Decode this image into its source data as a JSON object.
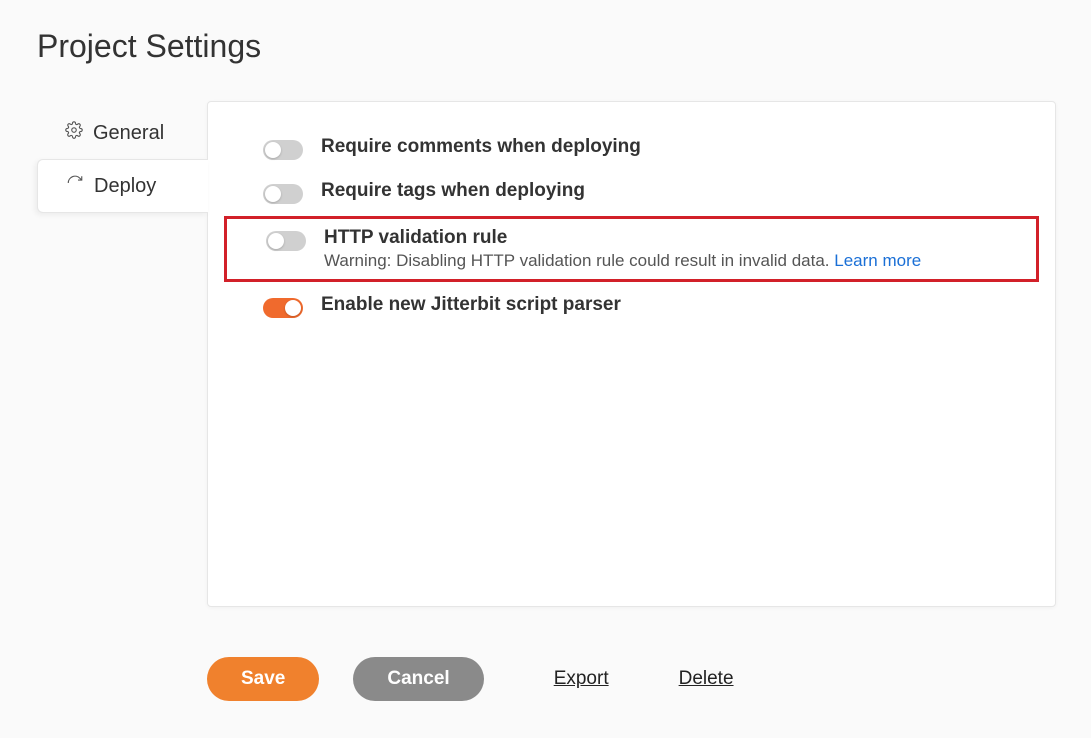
{
  "title": "Project Settings",
  "sidebar": {
    "tabs": [
      {
        "label": "General"
      },
      {
        "label": "Deploy"
      }
    ]
  },
  "settings": [
    {
      "label": "Require comments when deploying",
      "on": false,
      "desc": "",
      "link": "",
      "highlight": false
    },
    {
      "label": "Require tags when deploying",
      "on": false,
      "desc": "",
      "link": "",
      "highlight": false
    },
    {
      "label": "HTTP validation rule",
      "on": false,
      "desc": "Warning: Disabling HTTP validation rule could result in invalid data. ",
      "link": "Learn more",
      "highlight": true
    },
    {
      "label": "Enable new Jitterbit script parser",
      "on": true,
      "desc": "",
      "link": "",
      "highlight": false
    }
  ],
  "footer": {
    "save": "Save",
    "cancel": "Cancel",
    "export": "Export",
    "delete": "Delete"
  }
}
